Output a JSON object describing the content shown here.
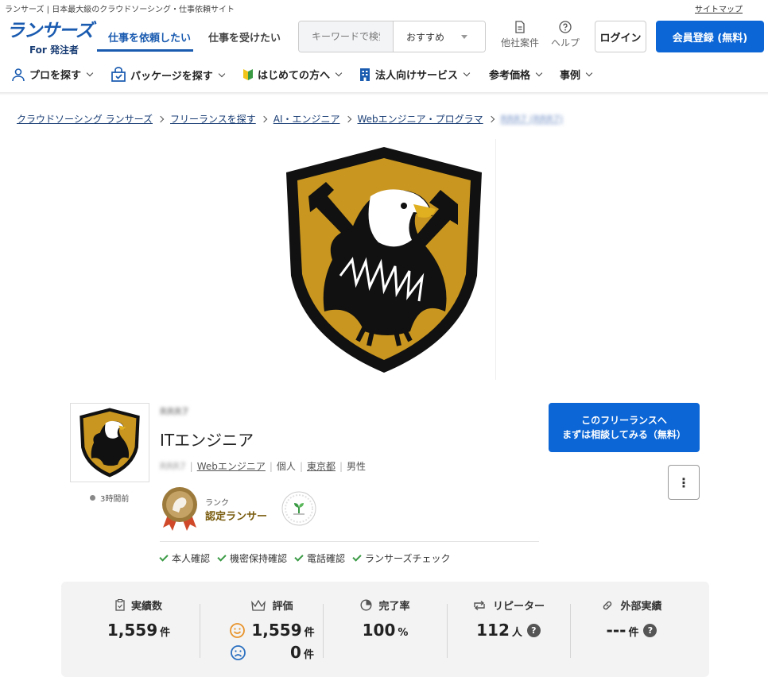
{
  "header": {
    "tagline": "ランサーズ | 日本最大級のクラウドソーシング・仕事依頼サイト",
    "sitemap": "サイトマップ",
    "logo_main": "ランサーズ",
    "logo_sub": "For 発注者",
    "tab_order": "仕事を依頼したい",
    "tab_work": "仕事を受けたい",
    "search_placeholder": "キーワードで検索",
    "search_select": "おすすめ",
    "other_projects": "他社案件",
    "help": "ヘルプ",
    "login": "ログイン",
    "signup": "会員登録 (無料)"
  },
  "nav": {
    "find_pro": "プロを探す",
    "find_package": "パッケージを探す",
    "beginners": "はじめての方へ",
    "corporate": "法人向けサービス",
    "price": "参考価格",
    "cases": "事例"
  },
  "breadcrumb": {
    "items": [
      "クラウドソーシング ランサーズ",
      "フリーランスを探す",
      "AI・エンジニア",
      "Webエンジニア・プログラマ"
    ],
    "current": "RRR7 (RRR7)"
  },
  "profile": {
    "username": "RRR7",
    "title": "ITエンジニア",
    "meta_id": "RRR7",
    "meta_category": "Webエンジニア",
    "meta_type": "個人",
    "meta_location": "東京都",
    "meta_gender": "男性",
    "online": "3時間前",
    "rank_label": "ランク",
    "rank_value": "認定ランサー",
    "verifications": [
      "本人確認",
      "機密保持確認",
      "電話確認",
      "ランサーズチェック"
    ],
    "cta_line1": "このフリーランスへ",
    "cta_line2": "まずは相談してみる（無料）",
    "more": "⋮"
  },
  "stats": {
    "jobs_label": "実績数",
    "jobs_value": "1,559",
    "jobs_unit": "件",
    "rating_label": "評価",
    "good_value": "1,559",
    "good_unit": "件",
    "bad_value": "0",
    "bad_unit": "件",
    "completion_label": "完了率",
    "completion_value": "100",
    "completion_unit": "%",
    "repeater_label": "リピーター",
    "repeater_value": "112",
    "repeater_unit": "人",
    "external_label": "外部実績",
    "external_value": "---",
    "external_unit": "件",
    "help_mark": "?"
  },
  "colors": {
    "brand": "#1a5bb0",
    "cta": "#0c66d6",
    "gold": "#c9961f"
  }
}
